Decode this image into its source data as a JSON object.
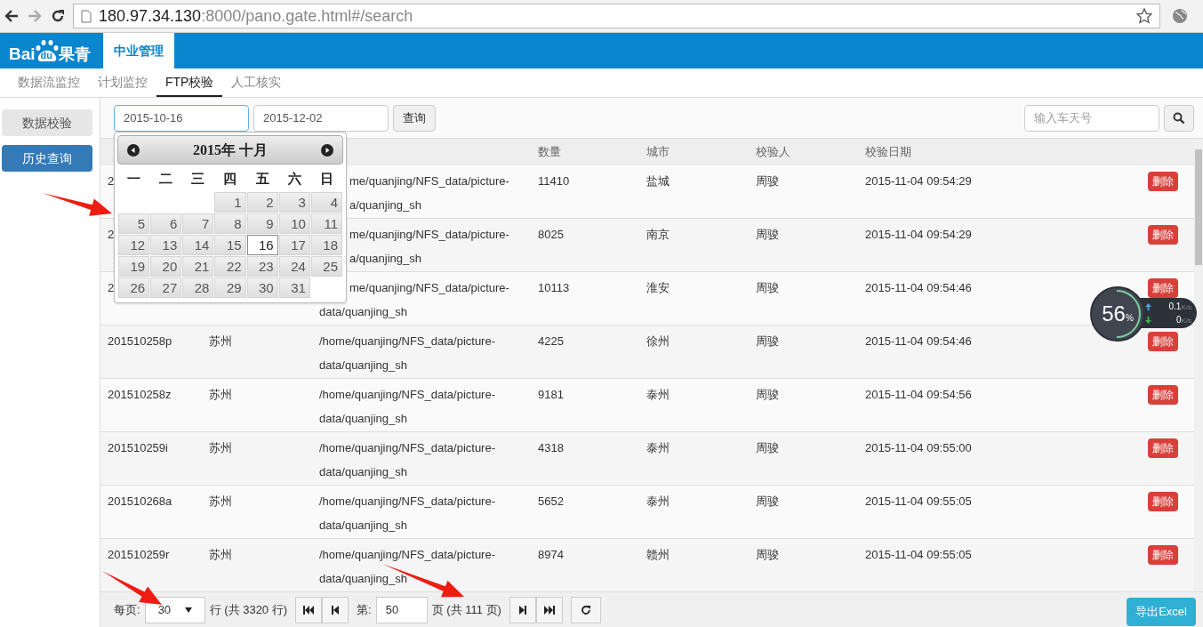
{
  "browser": {
    "url_host": "180.97.34.130",
    "url_rest": ":8000/pano.gate.html#/search"
  },
  "header": {
    "logo": {
      "left": "Bai",
      "paw": "du",
      "right": "果青"
    },
    "tabs": [
      {
        "label": "中业管理",
        "selected": true
      }
    ]
  },
  "subnav": [
    {
      "label": "数据流监控",
      "selected": false
    },
    {
      "label": "计划监控",
      "selected": false
    },
    {
      "label": "FTP校验",
      "selected": true
    },
    {
      "label": "人工核实",
      "selected": false
    }
  ],
  "sidebar": [
    {
      "label": "数据校验",
      "selected": false
    },
    {
      "label": "历史查询",
      "selected": true
    }
  ],
  "filters": {
    "start_date": "2015-10-16",
    "end_date": "2015-12-02",
    "query_button": "查询",
    "search_placeholder": "输入车天号"
  },
  "calendar": {
    "title": "2015年 十月",
    "weekdays": [
      "一",
      "二",
      "三",
      "四",
      "五",
      "六",
      "日"
    ],
    "weeks": [
      [
        {
          "kind": "blank"
        },
        {
          "kind": "blank"
        },
        {
          "kind": "blank"
        },
        {
          "kind": "day",
          "day": "1",
          "selected": false
        },
        {
          "kind": "day",
          "day": "2",
          "selected": false
        },
        {
          "kind": "day",
          "day": "3",
          "selected": false
        },
        {
          "kind": "day",
          "day": "4",
          "selected": false
        }
      ],
      [
        {
          "kind": "day",
          "day": "5",
          "selected": false
        },
        {
          "kind": "day",
          "day": "6",
          "selected": false
        },
        {
          "kind": "day",
          "day": "7",
          "selected": false
        },
        {
          "kind": "day",
          "day": "8",
          "selected": false
        },
        {
          "kind": "day",
          "day": "9",
          "selected": false
        },
        {
          "kind": "day",
          "day": "10",
          "selected": false
        },
        {
          "kind": "day",
          "day": "11",
          "selected": false
        }
      ],
      [
        {
          "kind": "day",
          "day": "12",
          "selected": false
        },
        {
          "kind": "day",
          "day": "13",
          "selected": false
        },
        {
          "kind": "day",
          "day": "14",
          "selected": false
        },
        {
          "kind": "day",
          "day": "15",
          "selected": false
        },
        {
          "kind": "day",
          "day": "16",
          "selected": true
        },
        {
          "kind": "day",
          "day": "17",
          "selected": false
        },
        {
          "kind": "day",
          "day": "18",
          "selected": false
        }
      ],
      [
        {
          "kind": "day",
          "day": "19",
          "selected": false
        },
        {
          "kind": "day",
          "day": "20",
          "selected": false
        },
        {
          "kind": "day",
          "day": "21",
          "selected": false
        },
        {
          "kind": "day",
          "day": "22",
          "selected": false
        },
        {
          "kind": "day",
          "day": "23",
          "selected": false
        },
        {
          "kind": "day",
          "day": "24",
          "selected": false
        },
        {
          "kind": "day",
          "day": "25",
          "selected": false
        }
      ],
      [
        {
          "kind": "day",
          "day": "26",
          "selected": false
        },
        {
          "kind": "day",
          "day": "27",
          "selected": false
        },
        {
          "kind": "day",
          "day": "28",
          "selected": false
        },
        {
          "kind": "day",
          "day": "29",
          "selected": false
        },
        {
          "kind": "day",
          "day": "30",
          "selected": false
        },
        {
          "kind": "day",
          "day": "31",
          "selected": false
        },
        {
          "kind": "blank"
        }
      ]
    ]
  },
  "table": {
    "columns": {
      "count": "数量",
      "city": "城市",
      "checker": "校验人",
      "check_date": "校验日期"
    },
    "rows": [
      {
        "id": "2",
        "path_lines": [
          {
            "text": "me/quanjing/NFS_data/picture-",
            "cut": true
          },
          {
            "text": "a/quanjing_sh",
            "cut": true
          }
        ],
        "count": "11410",
        "city": "盐城",
        "checker": "周骏",
        "check_date": "2015-11-04 09:54:29",
        "action": "删除"
      },
      {
        "id": "2",
        "path_lines": [
          {
            "text": "me/quanjing/NFS_data/picture-",
            "cut": true
          },
          {
            "text": "a/quanjing_sh",
            "cut": true
          }
        ],
        "count": "8025",
        "city": "南京",
        "checker": "周骏",
        "check_date": "2015-11-04 09:54:29",
        "action": "删除"
      },
      {
        "id": "2",
        "path_lines": [
          {
            "text": "me/quanjing/NFS_data/picture-",
            "cut": true
          },
          {
            "text": "data/quanjing_sh"
          }
        ],
        "count": "10113",
        "city": "淮安",
        "checker": "周骏",
        "check_date": "2015-11-04 09:54:46",
        "action": "删除"
      },
      {
        "id": "201510258p",
        "origin": "苏州",
        "path_lines": [
          {
            "text": "/home/quanjing/NFS_data/picture-",
            "cut": false
          },
          {
            "text": "data/quanjing_sh",
            "cut": false
          }
        ],
        "count": "4225",
        "city": "徐州",
        "checker": "周骏",
        "check_date": "2015-11-04 09:54:46",
        "action": "删除"
      },
      {
        "id": "201510258z",
        "origin": "苏州",
        "path_lines": [
          {
            "text": "/home/quanjing/NFS_data/picture-",
            "cut": false
          },
          {
            "text": "data/quanjing_sh",
            "cut": false
          }
        ],
        "count": "9181",
        "city": "泰州",
        "checker": "周骏",
        "check_date": "2015-11-04 09:54:56",
        "action": "删除"
      },
      {
        "id": "201510259i",
        "origin": "苏州",
        "path_lines": [
          {
            "text": "/home/quanjing/NFS_data/picture-",
            "cut": false
          },
          {
            "text": "data/quanjing_sh",
            "cut": false
          }
        ],
        "count": "4318",
        "city": "泰州",
        "checker": "周骏",
        "check_date": "2015-11-04 09:55:00",
        "action": "删除"
      },
      {
        "id": "201510268a",
        "origin": "苏州",
        "path_lines": [
          {
            "text": "/home/quanjing/NFS_data/picture-",
            "cut": false
          },
          {
            "text": "data/quanjing_sh",
            "cut": false
          }
        ],
        "count": "5652",
        "city": "泰州",
        "checker": "周骏",
        "check_date": "2015-11-04 09:55:05",
        "action": "删除"
      },
      {
        "id": "201510259r",
        "origin": "苏州",
        "path_lines": [
          {
            "text": "/home/quanjing/NFS_data/picture-",
            "cut": false
          },
          {
            "text": "data/quanjing_sh",
            "cut": false
          }
        ],
        "count": "8974",
        "city": "赣州",
        "checker": "周骏",
        "check_date": "2015-11-04 09:55:05",
        "action": "删除"
      }
    ]
  },
  "pager": {
    "per_page_label": "每页:",
    "per_page": "30",
    "rows_total": "行 (共 3320 行)",
    "page_label": "第:",
    "page": "50",
    "pages_total": "页 (共 111 页)",
    "export_button": "导出Excel"
  },
  "speed_widget": {
    "percent": "56",
    "percent_sign": "%",
    "upload": "0.1",
    "upload_unit": "K/s",
    "download": "0",
    "download_unit": "K/s"
  }
}
